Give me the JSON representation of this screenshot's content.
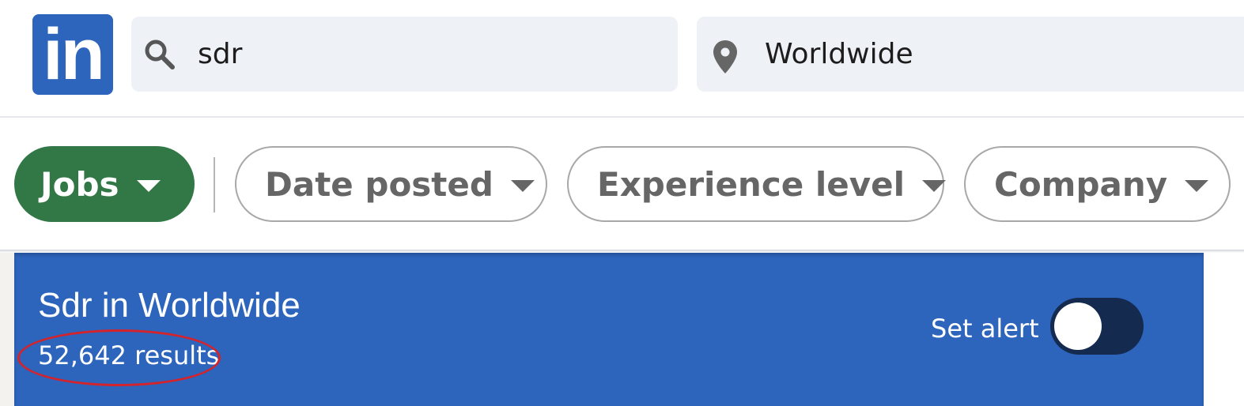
{
  "header": {
    "logo_text": "in",
    "search": {
      "value": "sdr",
      "icon": "search-icon"
    },
    "location": {
      "value": "Worldwide",
      "icon": "location-pin-icon"
    }
  },
  "filters": {
    "items": [
      {
        "label": "Jobs",
        "selected": true
      },
      {
        "label": "Date posted",
        "selected": false
      },
      {
        "label": "Experience level",
        "selected": false
      },
      {
        "label": "Company",
        "selected": false
      }
    ]
  },
  "results": {
    "title": "Sdr in Worldwide",
    "count_text": "52,642 results",
    "alert_label": "Set alert",
    "alert_on": false
  },
  "colors": {
    "brand_blue": "#2d64bc",
    "jobs_green": "#327846",
    "annotation_red": "#d5232b",
    "toggle_track": "#142a4e"
  }
}
